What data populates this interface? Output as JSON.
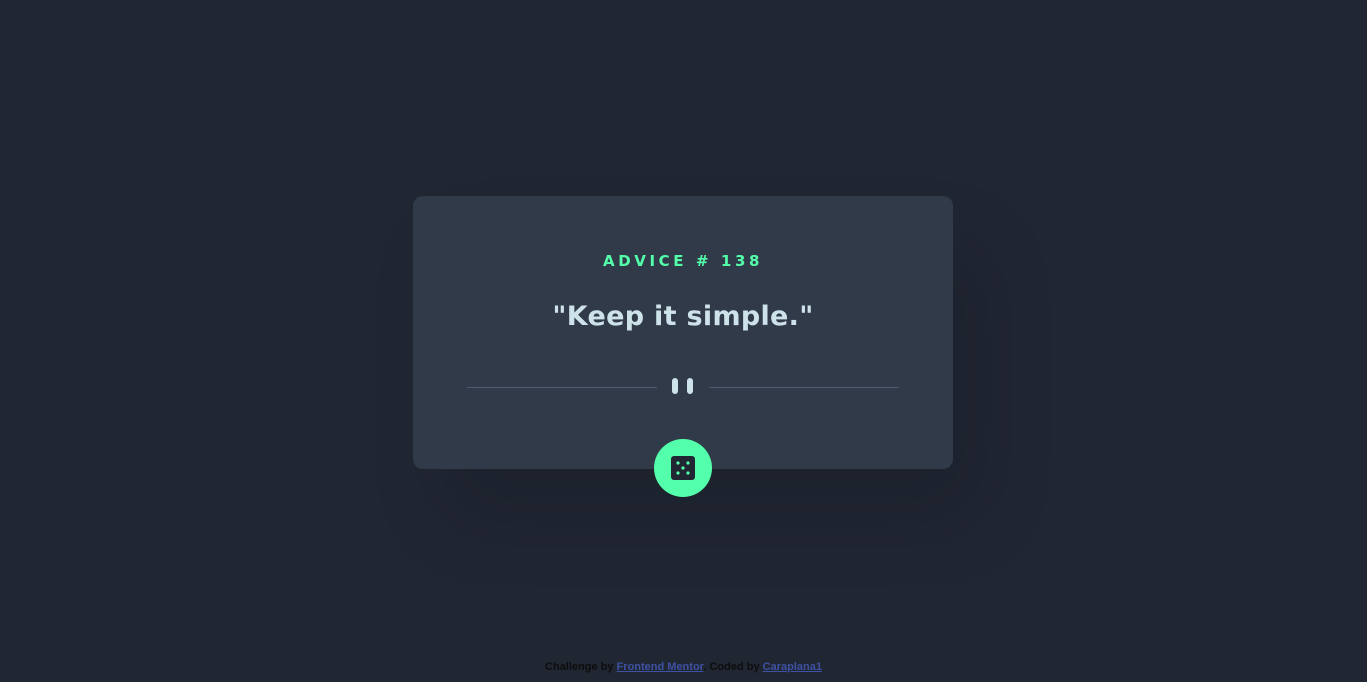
{
  "card": {
    "advice_label": "ADVICE # 138",
    "quote": "\"Keep it simple.\""
  },
  "dice_button": {
    "icon": "dice-icon",
    "accent_color": "#53ffaa"
  },
  "footer": {
    "challenge_prefix": "Challenge by",
    "challenge_link": "Frontend Mentor",
    "separator": ". Coded by",
    "coder_link": "Caraplana1"
  },
  "colors": {
    "background": "#202632",
    "card": "#313a48",
    "accent": "#53ffaa",
    "quote_text": "#cee3e9",
    "divider": "#4f5d74",
    "link": "#3e52a3"
  }
}
